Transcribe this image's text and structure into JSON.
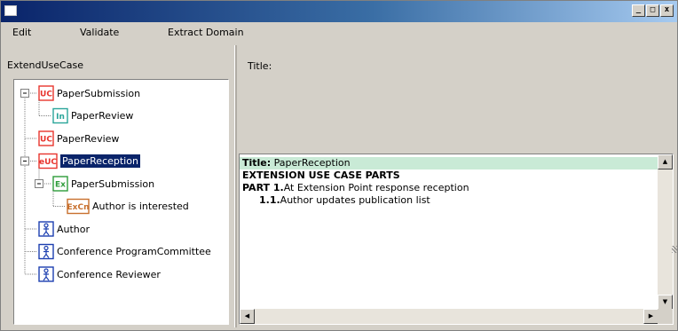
{
  "menu": {
    "items": [
      {
        "id": "edit",
        "label": "Edit"
      },
      {
        "id": "validate",
        "label": "Validate"
      },
      {
        "id": "extract",
        "label": "Extract Domain"
      }
    ]
  },
  "window_controls": {
    "minimize": "_",
    "maximize": "□",
    "close": "x"
  },
  "left_panel": {
    "header": "ExtendUseCase",
    "tree": [
      {
        "id": "n1",
        "label": "PaperSubmission",
        "badge": "UC",
        "badge_color": "#e8352e",
        "level": 0,
        "expander": "minus",
        "selected": false
      },
      {
        "id": "n2",
        "label": "PaperReview",
        "badge": "In",
        "badge_color": "#2aa59a",
        "level": 1,
        "expander": "",
        "selected": false
      },
      {
        "id": "n3",
        "label": "PaperReview",
        "badge": "UC",
        "badge_color": "#e8352e",
        "level": 0,
        "expander": "",
        "selected": false
      },
      {
        "id": "n4",
        "label": "PaperReception",
        "badge": "eUC",
        "badge_color": "#e8352e",
        "level": 0,
        "expander": "minus",
        "selected": true
      },
      {
        "id": "n5",
        "label": "PaperSubmission",
        "badge": "Ex",
        "badge_color": "#2e9c3a",
        "level": 1,
        "expander": "minus",
        "selected": false
      },
      {
        "id": "n6",
        "label": "Author is interested",
        "badge": "ExCn",
        "badge_color": "#c8702e",
        "level": 2,
        "expander": "",
        "selected": false
      },
      {
        "id": "n7",
        "label": "Author",
        "badge": "actor",
        "badge_color": "#1c3fb0",
        "level": 0,
        "expander": "",
        "selected": false
      },
      {
        "id": "n8",
        "label": "Conference ProgramCommittee",
        "badge": "actor",
        "badge_color": "#1c3fb0",
        "level": 0,
        "expander": "",
        "selected": false
      },
      {
        "id": "n9",
        "label": "Conference Reviewer",
        "badge": "actor",
        "badge_color": "#1c3fb0",
        "level": 0,
        "expander": "",
        "selected": false
      }
    ]
  },
  "right_panel": {
    "title_label": "Title:",
    "document": {
      "title_prefix": "Title:",
      "title_value": "PaperReception",
      "section_heading": "EXTENSION USE CASE PARTS",
      "part_prefix": "PART  1.",
      "part_text": "At Extension Point response reception",
      "sub_prefix": "1.1.",
      "sub_text": "Author updates publication list"
    }
  },
  "colors": {
    "titlebar_start": "#0a246a",
    "titlebar_end": "#a6caf0",
    "selection": "#0a246a",
    "highlight_row": "#c9ead6"
  }
}
